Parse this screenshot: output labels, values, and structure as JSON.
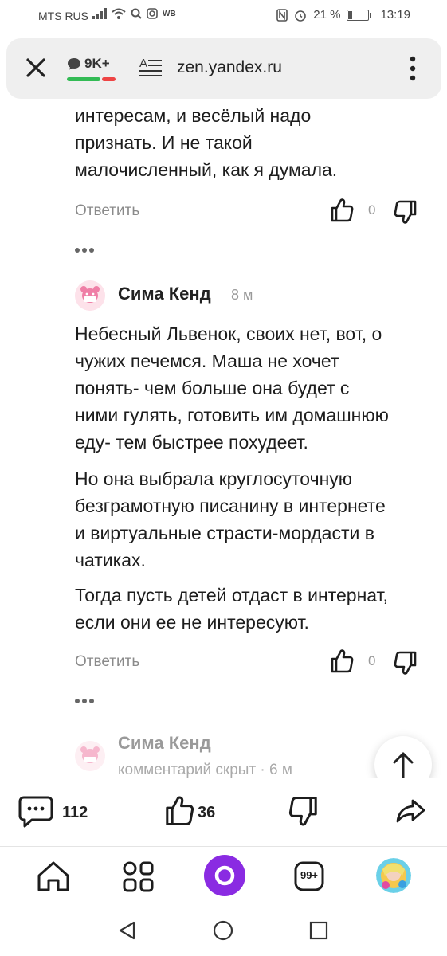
{
  "status_bar": {
    "carrier": "MTS RUS",
    "extra_label": "WB",
    "battery": "21 %",
    "battery_level": 0.21,
    "time": "13:19"
  },
  "browser_bar": {
    "comments_count": "9K+",
    "url": "zen.yandex.ru",
    "icons": [
      "close-icon",
      "chat-icon",
      "reader-mode-icon",
      "more-vertical-icon"
    ]
  },
  "comments": {
    "previous_tail": {
      "lines": [
        "интересам, и весёлый надо",
        "признать. И не такой",
        "малочисленный, как я думала."
      ],
      "reply": "Ответить",
      "likes": "0"
    },
    "main": {
      "author": "Сима Кенд",
      "time": "8 м",
      "paragraphs": [
        [
          "Небесный Львенок, своих нет, вот, о",
          "чужих печемся. Маша не хочет",
          "понять- чем больше она будет с",
          "ними гулять, готовить им домашнюю",
          "еду- тем быстрее похудеет."
        ],
        [
          "Но она выбрала круглосуточную",
          "безграмотную писанину в интернете",
          "и виртуальные страсти-мордасти в",
          "чатиках."
        ],
        [
          "Тогда пусть детей отдаст в интернат,",
          "если они ее не интересуют."
        ]
      ],
      "reply": "Ответить",
      "likes": "0"
    },
    "hidden": {
      "author": "Сима Кенд",
      "note": "комментарий скрыт · 6 м"
    }
  },
  "action_bar": {
    "comments": "112",
    "likes": "36",
    "icons": [
      "comments-icon",
      "like-icon",
      "dislike-icon",
      "share-icon"
    ]
  },
  "bottom_nav": {
    "tabs_badge": "99+",
    "icons": [
      "home-icon",
      "services-icon",
      "alice-icon",
      "tabs-icon",
      "profile-avatar"
    ]
  },
  "system_nav": {
    "icons": [
      "back-icon",
      "home-circle-icon",
      "recents-icon"
    ]
  },
  "colors": {
    "accent_purple": "#8a2be2",
    "green_bar": "#33bb55",
    "red_bar": "#ee4444"
  }
}
